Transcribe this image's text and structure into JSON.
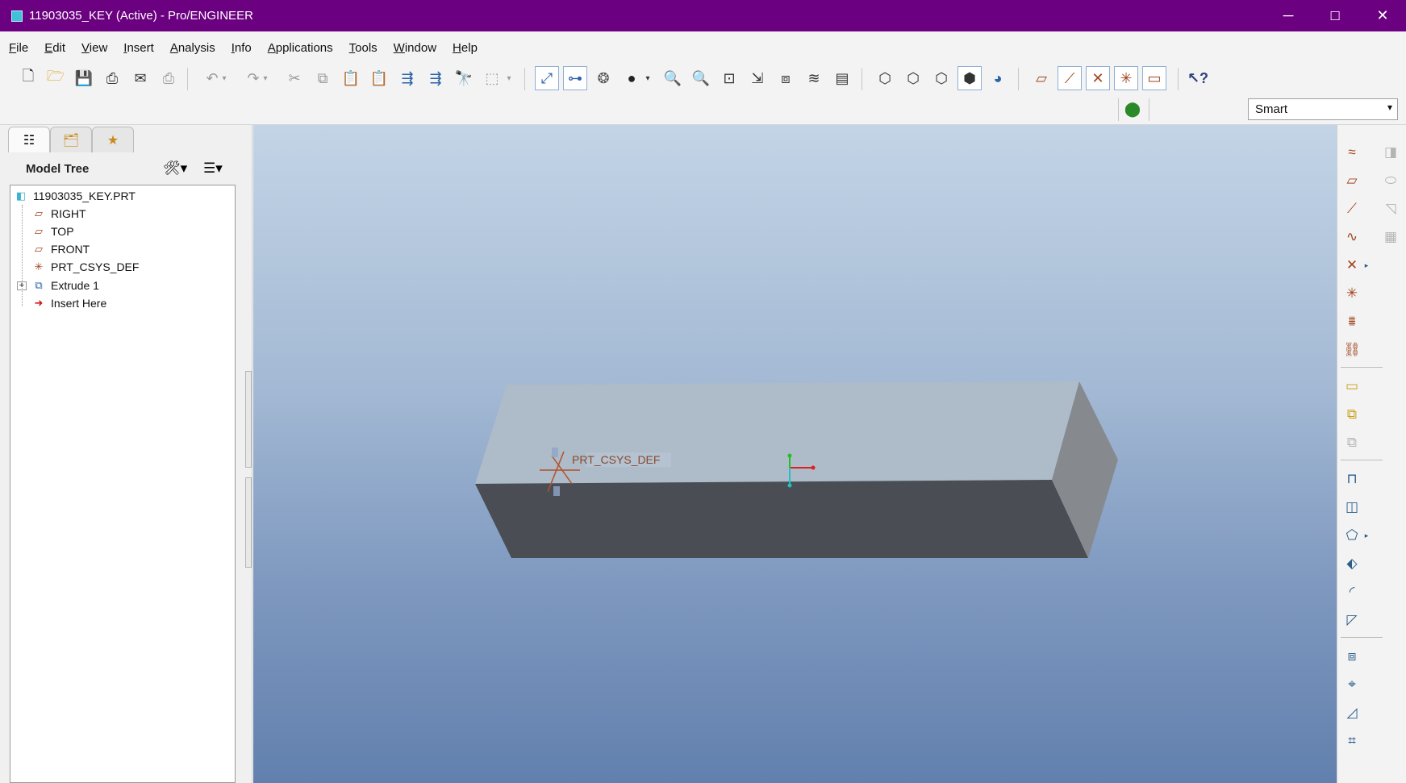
{
  "window": {
    "title": "11903035_KEY (Active) - Pro/ENGINEER",
    "min_glyph": "─",
    "max_glyph": "☐",
    "close_glyph": "✕"
  },
  "menu": [
    "File",
    "Edit",
    "View",
    "Insert",
    "Analysis",
    "Info",
    "Applications",
    "Tools",
    "Window",
    "Help"
  ],
  "filter": {
    "selected": "Smart",
    "arrow": "▾"
  },
  "model_tree": {
    "header": "Model Tree",
    "items": [
      {
        "label": "11903035_KEY.PRT",
        "icon": "part-icon"
      },
      {
        "label": "RIGHT",
        "icon": "datum-plane-icon"
      },
      {
        "label": "TOP",
        "icon": "datum-plane-icon"
      },
      {
        "label": "FRONT",
        "icon": "datum-plane-icon"
      },
      {
        "label": "PRT_CSYS_DEF",
        "icon": "csys-icon"
      },
      {
        "label": "Extrude 1",
        "icon": "extrude-icon"
      },
      {
        "label": "Insert Here",
        "icon": "insert-arrow-icon"
      }
    ]
  },
  "viewport": {
    "csys_label": "PRT_CSYS_DEF"
  },
  "colors": {
    "titlebar": "#6b0080",
    "box_top": "#aebbc8",
    "box_front": "#4a4e54",
    "box_side": "#868a8f"
  }
}
